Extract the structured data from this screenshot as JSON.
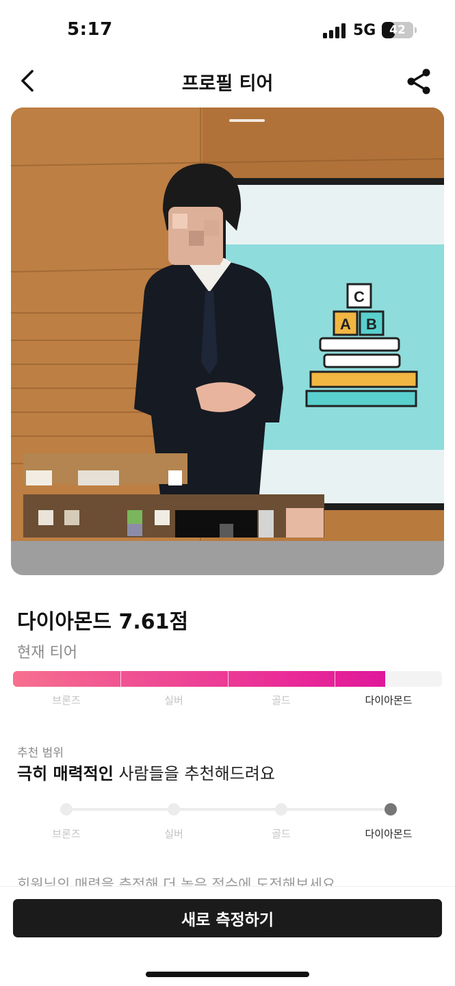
{
  "status_bar": {
    "time": "5:17",
    "network": "5G",
    "battery": "42",
    "battery_level": 0.42
  },
  "header": {
    "title": "프로필 티어",
    "back_icon": "chevron-left-icon",
    "share_icon": "share-icon"
  },
  "photo": {
    "description_icon": "profile-photo"
  },
  "tier": {
    "score_title": "다이아몬드 7.61점",
    "caption": "현재 티어",
    "fill_fraction": 0.867,
    "accent_start": "#f7708f",
    "accent_end": "#e0189a",
    "labels": [
      "브론즈",
      "실버",
      "골드",
      "다이아몬드"
    ],
    "active_index": 3
  },
  "range": {
    "caption": "추천 범위",
    "text_bold": "극히 매력적인",
    "text_rest": " 사람들을 추천해드려요",
    "labels": [
      "브론즈",
      "실버",
      "골드",
      "다이아몬드"
    ],
    "active_index": 3
  },
  "hint": "회원님의 매력을 측정해 더 높은 점수에 도전해보세요",
  "cta": {
    "label": "새로 측정하기"
  }
}
